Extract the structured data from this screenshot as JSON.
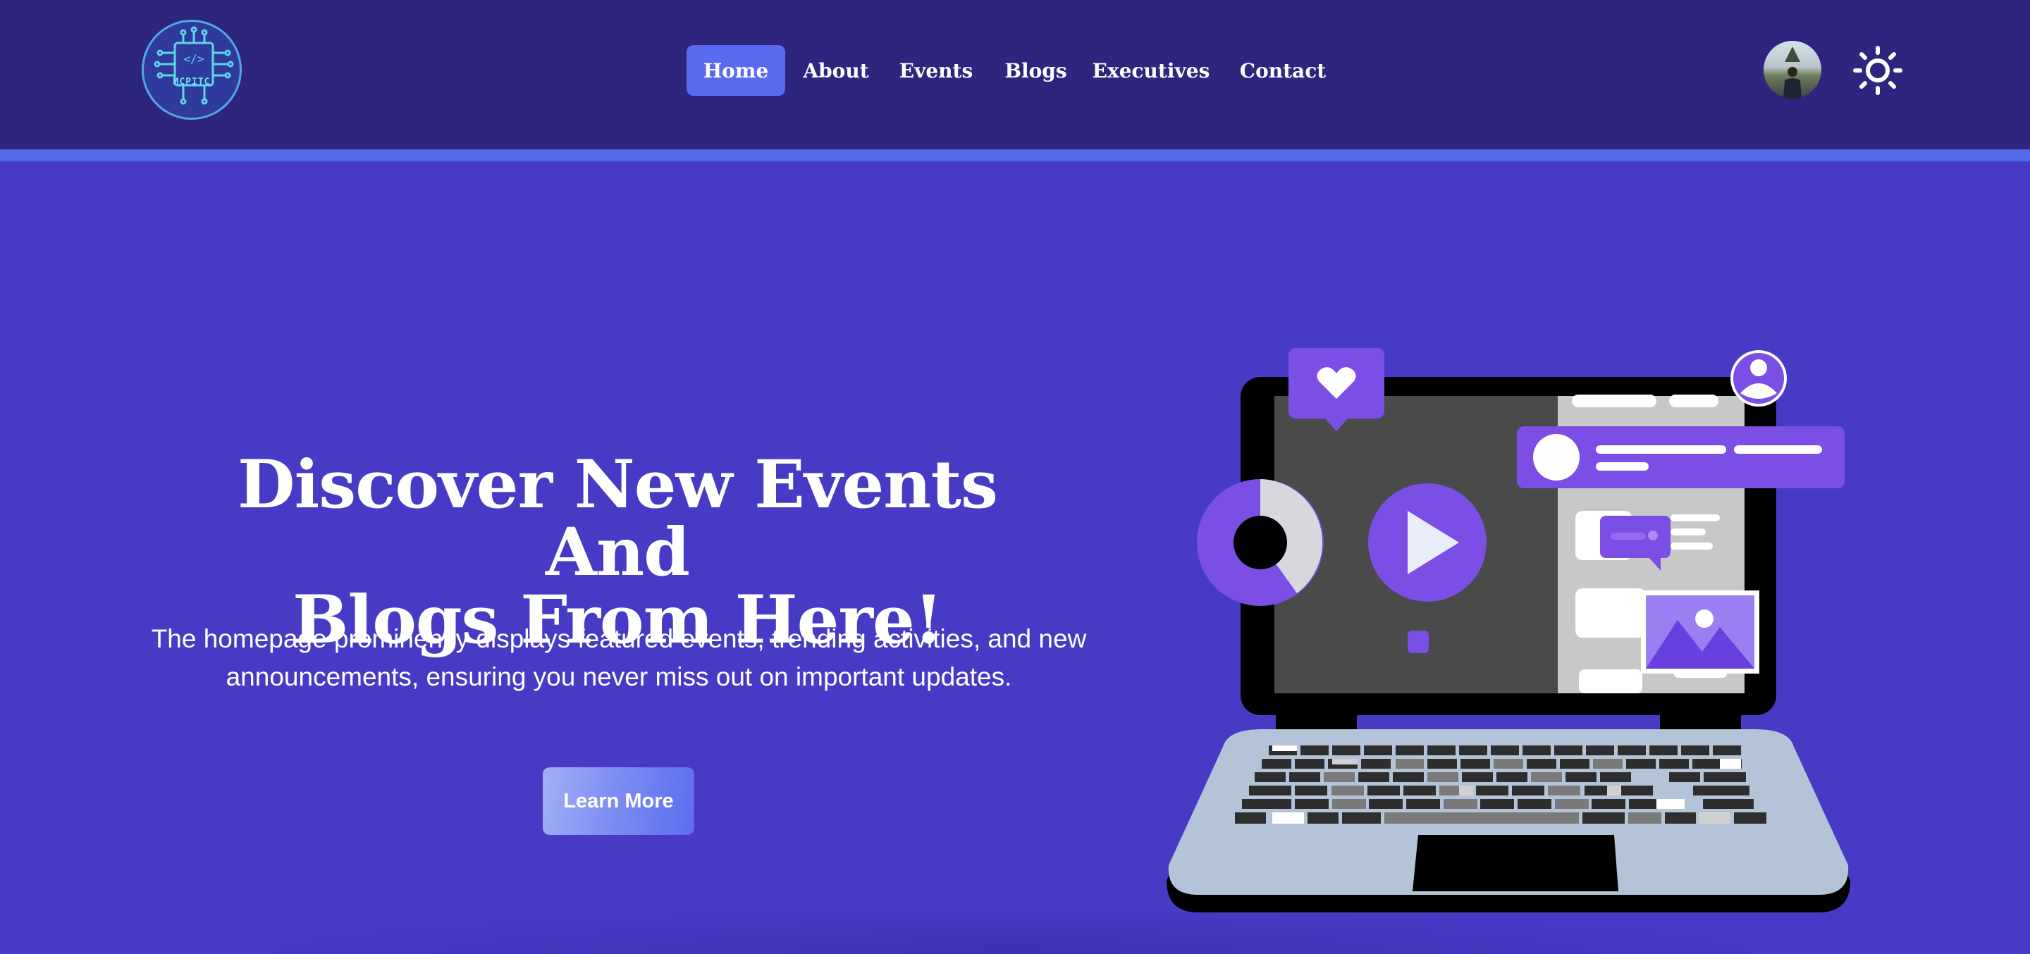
{
  "logo": {
    "text": "MCPITC",
    "icon": "circuit-chip-logo"
  },
  "nav": {
    "items": [
      {
        "label": "Home",
        "active": true
      },
      {
        "label": "About",
        "active": false
      },
      {
        "label": "Events",
        "active": false
      },
      {
        "label": "Blogs",
        "active": false
      },
      {
        "label": "Executives",
        "active": false
      },
      {
        "label": "Contact",
        "active": false
      }
    ]
  },
  "header_right": {
    "avatar": "user-avatar",
    "theme_toggle_icon": "sun-icon"
  },
  "hero": {
    "title_line1": "Discover New Events And",
    "title_line2": "Blogs From Here!",
    "description": "The homepage prominently displays featured events, trending activities, and new announcements, ensuring you never miss out on important updates.",
    "cta_label": "Learn More"
  },
  "colors": {
    "page_bg": "#473bc6",
    "header_bg": "#2e257f",
    "accent": "#5469ec",
    "illustration_purple": "#7b4fe6"
  }
}
